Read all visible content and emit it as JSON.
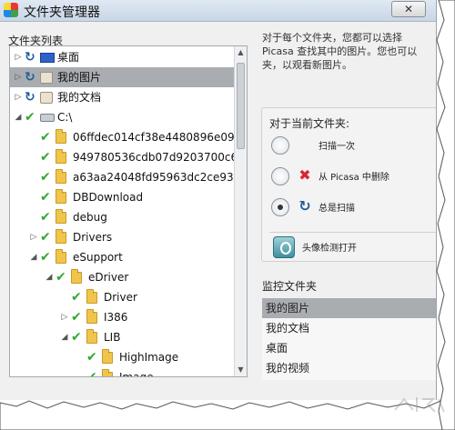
{
  "window": {
    "title": "文件夹管理器",
    "close_label": "✕"
  },
  "folder_list": {
    "title": "文件夹列表",
    "rows": [
      {
        "depth": 0,
        "expander": "▷",
        "state": "refresh",
        "icon": "desktop-icon",
        "label": "桌面",
        "selected": false
      },
      {
        "depth": 0,
        "expander": "▷",
        "state": "refresh",
        "icon": "pictures-icon",
        "label": "我的图片",
        "selected": true
      },
      {
        "depth": 0,
        "expander": "▷",
        "state": "refresh",
        "icon": "documents-icon",
        "label": "我的文档",
        "selected": false
      },
      {
        "depth": 0,
        "expander": "◢",
        "state": "check",
        "icon": "drive-icon",
        "label": "C:\\",
        "selected": false
      },
      {
        "depth": 1,
        "expander": "",
        "state": "check",
        "icon": "folder-icon",
        "label": "06ffdec014cf38e4480896e0969e",
        "selected": false
      },
      {
        "depth": 1,
        "expander": "",
        "state": "check",
        "icon": "folder-icon",
        "label": "949780536cdb07d9203700c656",
        "selected": false
      },
      {
        "depth": 1,
        "expander": "",
        "state": "check",
        "icon": "folder-icon",
        "label": "a63aa24048fd95963dc2ce939a",
        "selected": false
      },
      {
        "depth": 1,
        "expander": "",
        "state": "check",
        "icon": "folder-icon",
        "label": "DBDownload",
        "selected": false
      },
      {
        "depth": 1,
        "expander": "",
        "state": "check",
        "icon": "folder-icon",
        "label": "debug",
        "selected": false
      },
      {
        "depth": 1,
        "expander": "▷",
        "state": "check",
        "icon": "folder-icon",
        "label": "Drivers",
        "selected": false
      },
      {
        "depth": 1,
        "expander": "◢",
        "state": "check",
        "icon": "folder-icon",
        "label": "eSupport",
        "selected": false
      },
      {
        "depth": 2,
        "expander": "◢",
        "state": "check",
        "icon": "folder-icon",
        "label": "eDriver",
        "selected": false
      },
      {
        "depth": 3,
        "expander": "",
        "state": "check",
        "icon": "folder-icon",
        "label": "Driver",
        "selected": false
      },
      {
        "depth": 3,
        "expander": "▷",
        "state": "check",
        "icon": "folder-icon",
        "label": "I386",
        "selected": false
      },
      {
        "depth": 3,
        "expander": "◢",
        "state": "check",
        "icon": "folder-icon",
        "label": "LIB",
        "selected": false
      },
      {
        "depth": 4,
        "expander": "",
        "state": "check",
        "icon": "folder-icon",
        "label": "HighImage",
        "selected": false
      },
      {
        "depth": 4,
        "expander": "",
        "state": "check",
        "icon": "folder-icon",
        "label": "Image",
        "selected": false
      }
    ]
  },
  "description": [
    "对于每个文件夹，您都可以选择",
    "Picasa 查找其中的图片。您也可以",
    "夹，以观看新图片。"
  ],
  "current_folder": {
    "title": "对于当前文件夹:",
    "options": [
      {
        "label": "扫描一次",
        "icon": "",
        "selected": false
      },
      {
        "label": "从 Picasa 中删除",
        "icon": "red-x-icon",
        "selected": false
      },
      {
        "label": "总是扫描",
        "icon": "refresh-icon",
        "selected": true
      }
    ],
    "face_detection": "头像检测打开"
  },
  "watched": {
    "title": "监控文件夹",
    "items": [
      {
        "label": "我的图片",
        "selected": true
      },
      {
        "label": "我的文档",
        "selected": false
      },
      {
        "label": "桌面",
        "selected": false
      },
      {
        "label": "我的视频",
        "selected": false
      }
    ]
  },
  "colors": {
    "selection": "#a9acb1",
    "check": "#2fa832",
    "refresh": "#1f5d9c",
    "folder": "#f1c54c",
    "remove": "#d9262c"
  }
}
